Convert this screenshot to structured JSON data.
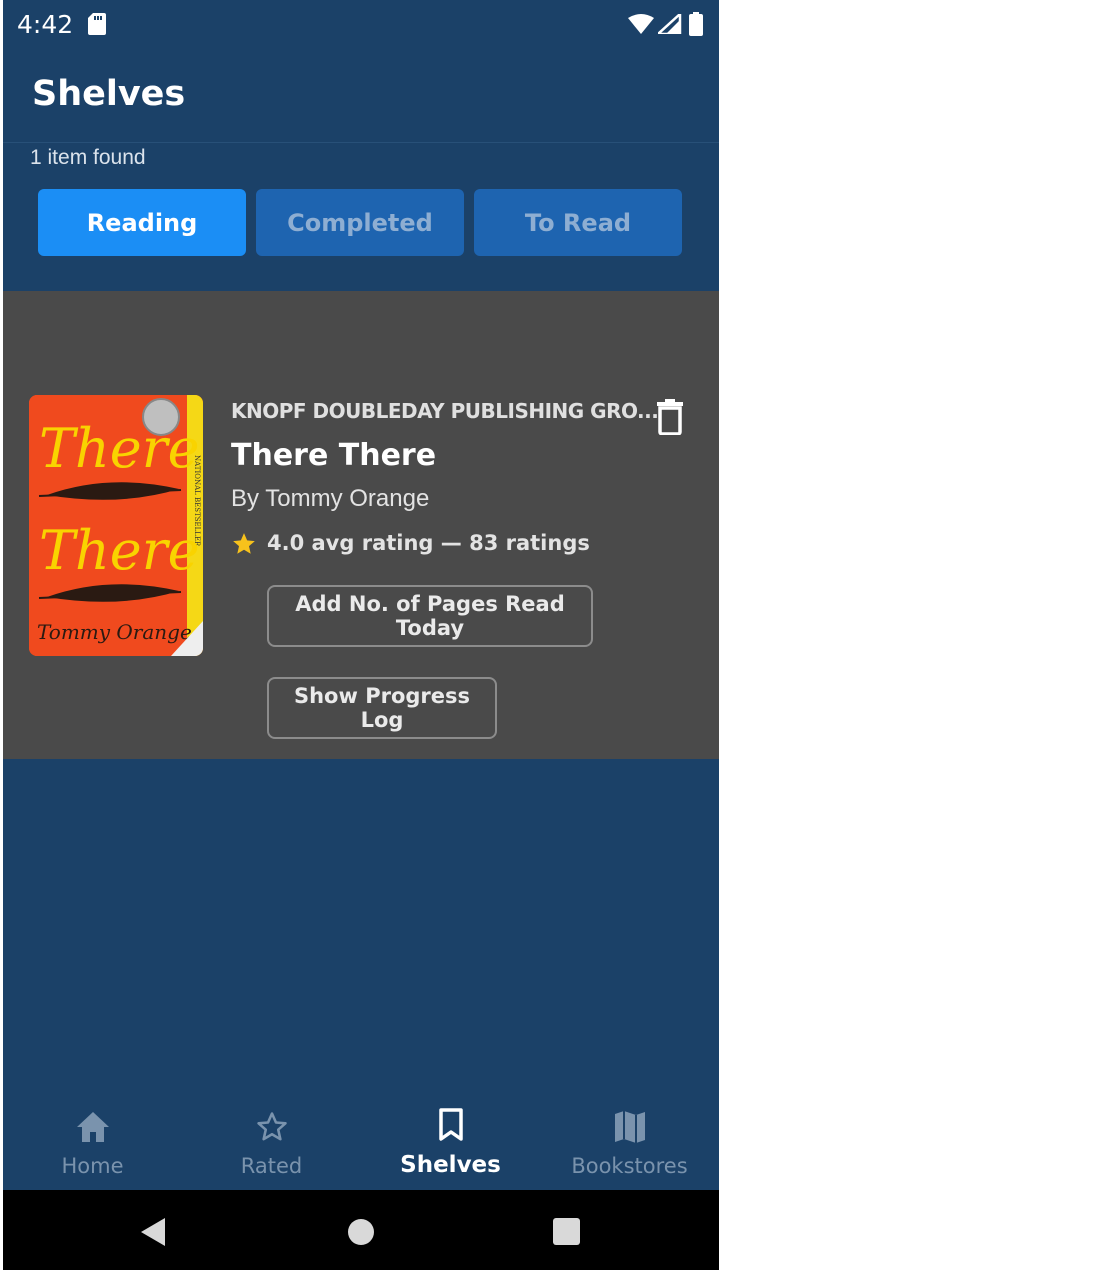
{
  "status_bar": {
    "time": "4:42"
  },
  "header": {
    "title": "Shelves",
    "items_found": "1 item found"
  },
  "tabs": [
    {
      "label": "Reading",
      "active": true
    },
    {
      "label": "Completed",
      "active": false
    },
    {
      "label": "To Read",
      "active": false
    }
  ],
  "book": {
    "publisher": "KNOPF DOUBLEDAY PUBLISHING GRO...",
    "title": "There There",
    "author": "By Tommy Orange",
    "rating": "4.0 avg rating — 83 ratings",
    "cover": {
      "title_line1": "There",
      "title_line2": "There",
      "author": "Tommy Orange",
      "spine": "NATIONAL BESTSELLER"
    },
    "add_pages_label": "Add No. of Pages Read Today",
    "progress_log_label": "Show Progress Log"
  },
  "bottom_nav": [
    {
      "label": "Home",
      "icon": "home-icon",
      "active": false
    },
    {
      "label": "Rated",
      "icon": "star-outline-icon",
      "active": false
    },
    {
      "label": "Shelves",
      "icon": "bookmark-icon",
      "active": true
    },
    {
      "label": "Bookstores",
      "icon": "map-icon",
      "active": false
    }
  ],
  "colors": {
    "background": "#1b4168",
    "tab_active": "#1b8ef5",
    "tab_inactive": "#1e64b0",
    "card": "#4a4a4a",
    "star": "#f7c21c"
  }
}
